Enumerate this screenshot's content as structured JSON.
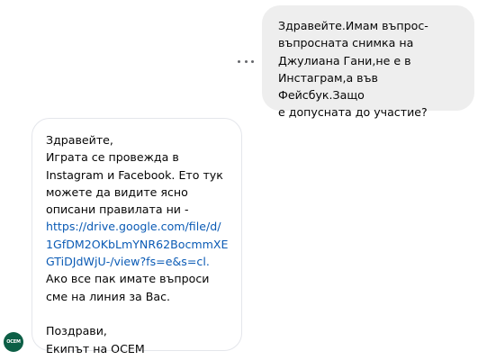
{
  "conversation": {
    "sent_message": {
      "text": "Здравейте.Имам въпрос-\nвъпросната снимка на\nДжулиана Гани,не е в\nИнстаграм,а във Фейсбук.Защо\nе допусната до участие?"
    },
    "received_message": {
      "text_before_link": "Здравейте,\nИграта се провежда в\nInstagram и Facebook. Ето тук\nможете да видите ясно\nописани правилата ни -",
      "link_text": "https://drive.google.com/file/d/\n1GfDM2OKbLmYNR62BocmmXE\nGTiDJdWjU-/view?fs=e&s=cl.",
      "text_after_link": "Ако все пак имате въпроси\nсме на линия за Вас.\n\nПоздрави,\nЕкипът на ОСЕМ"
    },
    "sender": {
      "avatar_label": "OCEM"
    },
    "icons": {
      "more_options": "more-horizontal-icon"
    },
    "colors": {
      "sent_bubble": "#eeeeee",
      "received_border": "#e4e6eb",
      "link": "#0b5bb5",
      "avatar_background": "#0d5f46"
    }
  }
}
